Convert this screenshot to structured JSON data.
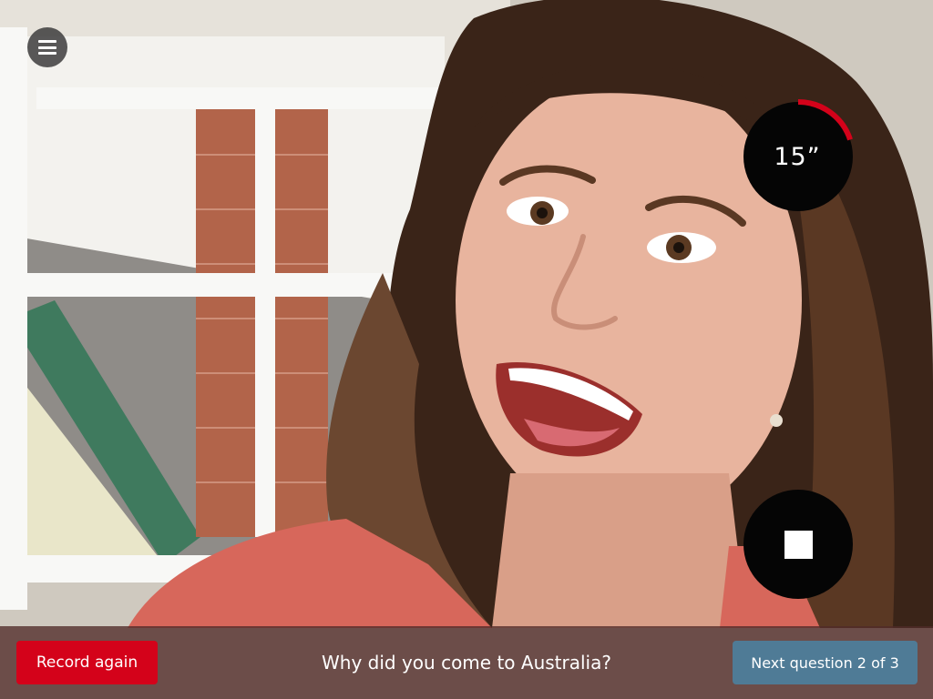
{
  "preview": {
    "icon": "camera-preview"
  },
  "menu": {
    "icon": "hamburger-menu-icon"
  },
  "timer": {
    "text": "15”",
    "progress_fraction": 0.2,
    "ring_color": "#d4021a"
  },
  "stop": {
    "icon": "stop-icon"
  },
  "bottom_bar": {
    "record_again_label": "Record again",
    "question": "Why did you come to Australia?",
    "next_question_label": "Next question 2 of 3"
  },
  "colors": {
    "accent_red": "#d4021a",
    "next_blue": "#4f7b96",
    "bar_bg": "#502a28"
  }
}
